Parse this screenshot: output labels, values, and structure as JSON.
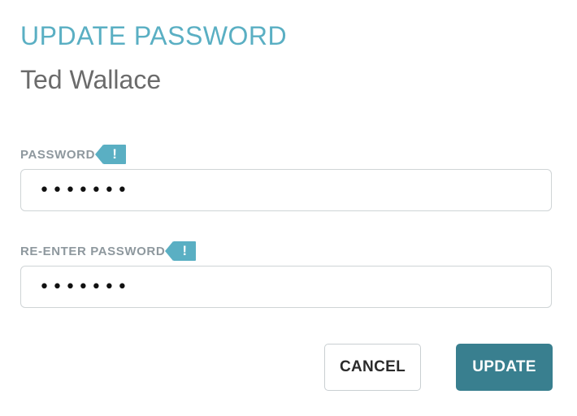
{
  "dialog": {
    "title": "UPDATE PASSWORD",
    "user_name": "Ted Wallace"
  },
  "fields": {
    "password": {
      "label": "PASSWORD",
      "value": "•••••••",
      "alert": "!"
    },
    "reenter_password": {
      "label": "RE-ENTER PASSWORD",
      "value": "•••••••",
      "alert": "!"
    }
  },
  "actions": {
    "cancel_label": "CANCEL",
    "update_label": "UPDATE"
  },
  "colors": {
    "accent": "#5aafc3",
    "primary_button": "#397f8f",
    "label_gray": "#8e989e",
    "subtitle_gray": "#6b6b6b",
    "input_border": "#cfd4d6"
  },
  "icons": {
    "alert": "exclamation-icon"
  }
}
